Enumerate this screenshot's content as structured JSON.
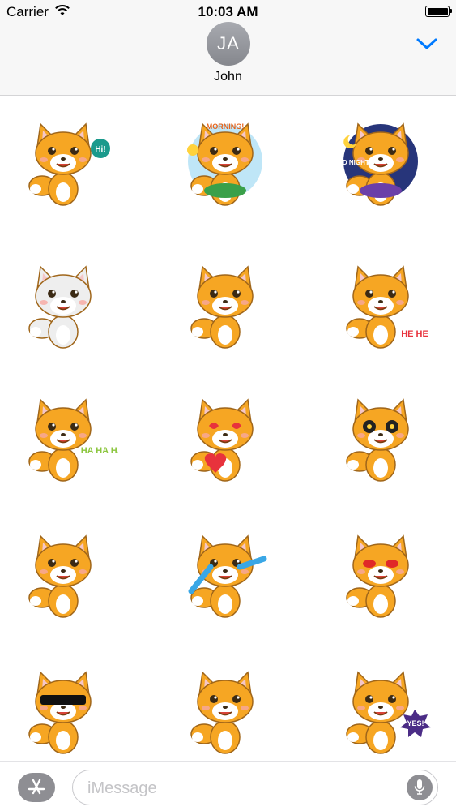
{
  "status_bar": {
    "carrier": "Carrier",
    "time": "10:03 AM",
    "battery_level": 1.0
  },
  "header": {
    "avatar_initials": "JA",
    "contact_name": "John"
  },
  "stickers": [
    {
      "name": "fox-hi",
      "fur": "#f6a623",
      "caption": "Hi!"
    },
    {
      "name": "fox-morning",
      "fur": "#f6a623",
      "caption": "MORNING!"
    },
    {
      "name": "fox-good-night",
      "fur": "#f6a623",
      "caption": "GOOD NIGHT"
    },
    {
      "name": "fox-white-shocked",
      "fur": "#eeeeee",
      "caption": ""
    },
    {
      "name": "fox-grinning",
      "fur": "#f6a623",
      "caption": ""
    },
    {
      "name": "fox-hehe",
      "fur": "#f6a623",
      "caption": "HE HE"
    },
    {
      "name": "fox-hahaha",
      "fur": "#f6a623",
      "caption": "HA HA HA!"
    },
    {
      "name": "fox-kiss-heart",
      "fur": "#f6a623",
      "caption": ""
    },
    {
      "name": "fox-star-eyes",
      "fur": "#f6a623",
      "caption": ""
    },
    {
      "name": "fox-shy",
      "fur": "#f6a623",
      "caption": ""
    },
    {
      "name": "fox-crying",
      "fur": "#f6a623",
      "caption": ""
    },
    {
      "name": "fox-angry",
      "fur": "#f6a623",
      "caption": ""
    },
    {
      "name": "fox-sunglasses",
      "fur": "#f6a623",
      "caption": ""
    },
    {
      "name": "fox-gloomy",
      "fur": "#f6a623",
      "caption": ""
    },
    {
      "name": "fox-yes",
      "fur": "#f6a623",
      "caption": "YES!"
    }
  ],
  "input_bar": {
    "placeholder": "iMessage"
  },
  "colors": {
    "accent": "#007aff",
    "fox_orange": "#f6a623",
    "header_bg": "#f7f7f7"
  },
  "icons": {
    "appstore": "appstore-icon",
    "mic": "mic-icon",
    "chevron": "chevron-down-icon"
  }
}
